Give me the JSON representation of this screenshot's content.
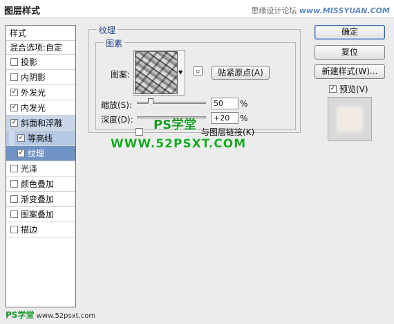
{
  "window": {
    "title": "图层样式",
    "watermark_left": "思缘设计论坛",
    "watermark_url": "www.MISSYUAN.COM"
  },
  "sidebar": {
    "header": "样式",
    "blend_options": "混合选项:自定",
    "items": [
      {
        "label": "投影",
        "checked": false
      },
      {
        "label": "内阴影",
        "checked": false
      },
      {
        "label": "外发光",
        "checked": true
      },
      {
        "label": "内发光",
        "checked": true
      },
      {
        "label": "斜面和浮雕",
        "checked": true
      },
      {
        "label": "等高线",
        "checked": true
      },
      {
        "label": "纹理",
        "checked": true
      },
      {
        "label": "光泽",
        "checked": false
      },
      {
        "label": "颜色叠加",
        "checked": false
      },
      {
        "label": "渐变叠加",
        "checked": false
      },
      {
        "label": "图案叠加",
        "checked": false
      },
      {
        "label": "描边",
        "checked": false
      }
    ]
  },
  "texture": {
    "section_title": "纹理",
    "subsection_title": "图素",
    "pattern_label": "图案:",
    "snap_button": "贴紧原点(A)",
    "scale_label": "缩放(S):",
    "scale_value": "50",
    "scale_unit": "%",
    "scale_fraction": 0.2,
    "depth_label": "深度(D):",
    "depth_value": "+20",
    "depth_unit": "%",
    "link_label": "与图层链接(K)",
    "link_checked": false
  },
  "right_panel": {
    "ok": "确定",
    "reset": "复位",
    "new_style": "新建样式(W)...",
    "preview_label": "预览(V)",
    "preview_checked": true
  },
  "overlay": {
    "ps_watermark": "PS学堂",
    "site_watermark": "WWW.52PSXT.COM",
    "bottom_watermark_ps": "PS学堂",
    "bottom_watermark_url": "www.52psxt.com"
  }
}
